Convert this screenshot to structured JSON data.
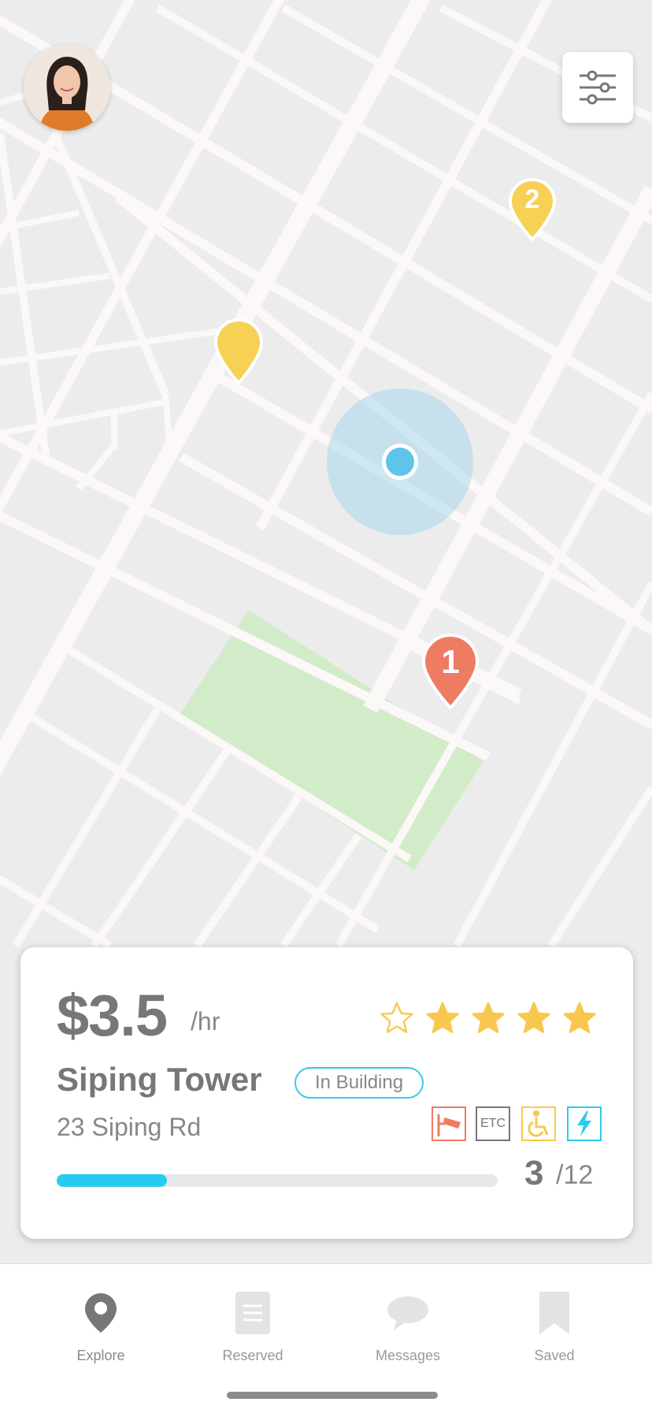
{
  "map": {
    "marker_1_label": "1",
    "marker_2_label": "2",
    "colors": {
      "pin_yellow": "#f7d155",
      "pin_red": "#ee7c63",
      "user_dot": "#5ec4ea",
      "park": "#d2ecc9"
    }
  },
  "header": {
    "avatar": "user-avatar",
    "filter_icon": "sliders-icon"
  },
  "listing": {
    "price": "$3.5",
    "price_unit": "/hr",
    "rating": 4,
    "rating_max": 5,
    "name": "Siping Tower",
    "badge": "In Building",
    "address": "23 Siping Rd",
    "amenities": [
      {
        "icon": "security-camera-icon"
      },
      {
        "icon": "etc-icon",
        "label": "ETC"
      },
      {
        "icon": "wheelchair-icon"
      },
      {
        "icon": "ev-charging-icon"
      }
    ],
    "availability_fraction": 0.25,
    "spots_available": "3",
    "spots_total": "/12",
    "accent": "#27cbef"
  },
  "tabbar": {
    "tabs": [
      {
        "label": "Explore",
        "icon": "map-pin-icon"
      },
      {
        "label": "Reserved",
        "icon": "document-icon"
      },
      {
        "label": "Messages",
        "icon": "chat-bubble-icon"
      },
      {
        "label": "Saved",
        "icon": "bookmark-icon"
      }
    ]
  }
}
